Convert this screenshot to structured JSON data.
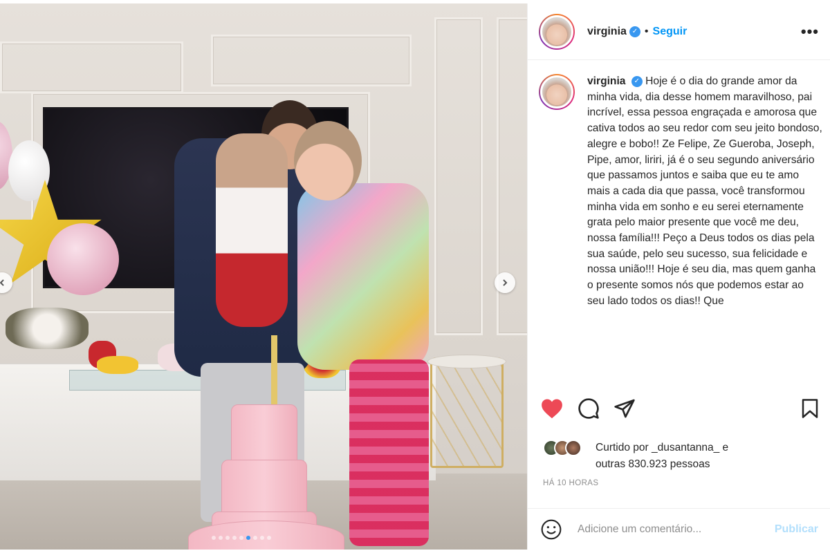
{
  "post": {
    "username": "virginia",
    "separator": "•",
    "follow_label": "Seguir",
    "more_label": "•••"
  },
  "caption": {
    "username": "virginia",
    "text": "Hoje é o dia do grande amor da minha vida, dia desse homem maravilhoso, pai incrível, essa pessoa engraçada e amorosa que cativa todos ao seu redor com seu jeito bondoso, alegre e bobo!! Ze Felipe, Ze Gueroba, Joseph, Pipe, amor, liriri, já é o seu segundo aniversário que passamos juntos e saiba que eu te amo mais a cada dia que passa, você transformou minha vida em sonho e eu serei eternamente grata pelo maior presente que você me deu, nossa família!!! Peço a Deus todos os dias pela sua saúde, pelo seu sucesso, sua felicidade e nossa união!!! Hoje é seu dia, mas quem ganha o presente somos nós que podemos estar ao seu lado todos os dias!! Que"
  },
  "likes": {
    "text_prefix": "Curtido por ",
    "liker": "_dusantanna_",
    "text_suffix": " e",
    "others": "outras 830.923 pessoas"
  },
  "timestamp": "HÁ 10 HORAS",
  "comment": {
    "placeholder": "Adicione um comentário...",
    "publish_label": "Publicar"
  },
  "carousel": {
    "slide_count": 9,
    "active_index": 5
  },
  "colors": {
    "like_red": "#ed4956",
    "follow_blue": "#0095f6",
    "verified_blue": "#3897f0",
    "publish_disabled": "#b2dffc"
  },
  "icons": {
    "like": "heart-icon",
    "comment": "comment-icon",
    "share": "paper-plane-icon",
    "save": "bookmark-icon",
    "emoji": "emoji-icon",
    "verified": "verified-badge-icon",
    "prev": "chevron-left-icon",
    "next": "chevron-right-icon"
  }
}
